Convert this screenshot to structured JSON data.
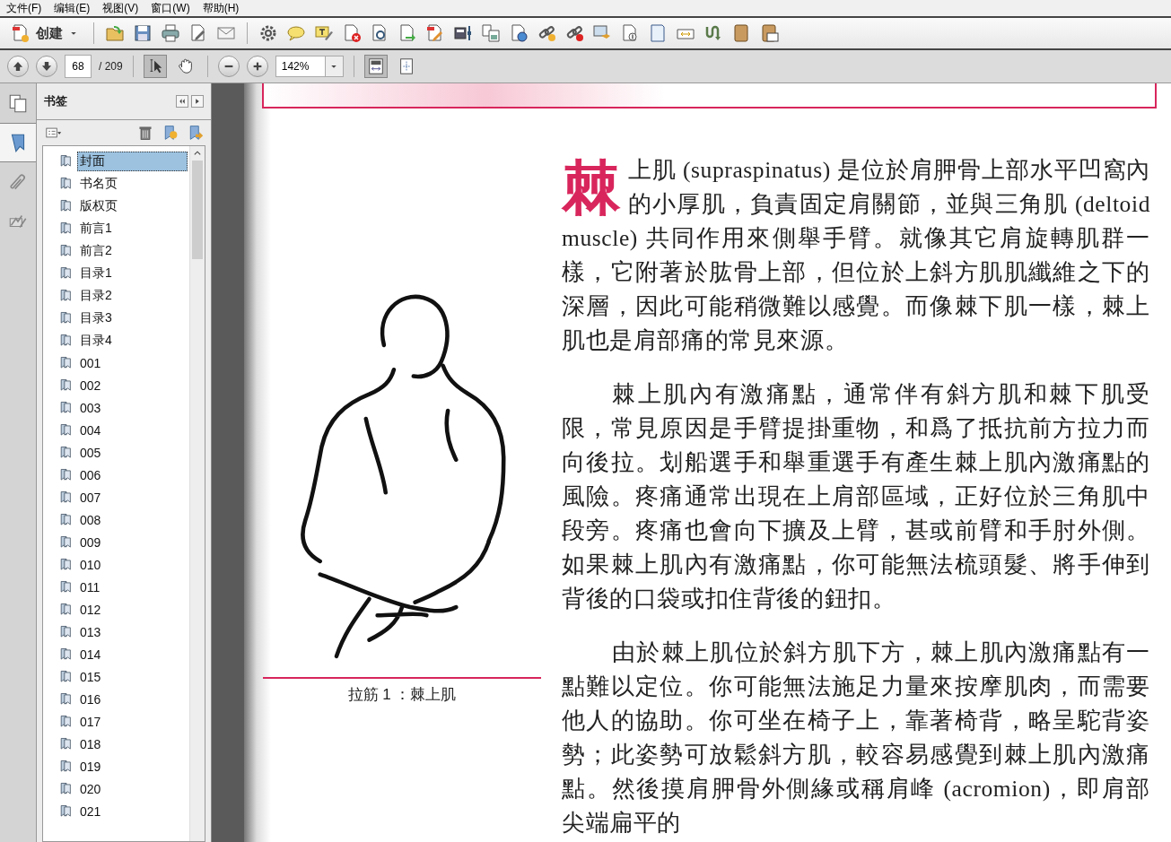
{
  "menu": [
    {
      "label": "文件(F)"
    },
    {
      "label": "编辑(E)"
    },
    {
      "label": "视图(V)"
    },
    {
      "label": "窗口(W)"
    },
    {
      "label": "帮助(H)"
    }
  ],
  "toolbar": {
    "create_label": "创建"
  },
  "navigation": {
    "page": "68",
    "total": "/ 209",
    "zoom": "142%",
    "tools": [
      {
        "kind": "select",
        "selected": true
      },
      {
        "kind": "hand",
        "selected": false
      }
    ],
    "views": [
      {
        "kind": "fit-page",
        "selected": true
      },
      {
        "kind": "fit-window",
        "selected": false
      }
    ]
  },
  "side_tabs": [
    {
      "kind": "pages",
      "selected": false
    },
    {
      "kind": "bookmarks",
      "selected": true
    },
    {
      "kind": "attachments",
      "selected": false
    },
    {
      "kind": "signatures",
      "selected": false
    }
  ],
  "bookmarks": {
    "title": "书签",
    "items": [
      {
        "label": "封面",
        "selected": true
      },
      {
        "label": "书名页",
        "selected": false
      },
      {
        "label": "版权页",
        "selected": false
      },
      {
        "label": "前言1",
        "selected": false
      },
      {
        "label": "前言2",
        "selected": false
      },
      {
        "label": "目录1",
        "selected": false
      },
      {
        "label": "目录2",
        "selected": false
      },
      {
        "label": "目录3",
        "selected": false
      },
      {
        "label": "目录4",
        "selected": false
      },
      {
        "label": "001",
        "selected": false
      },
      {
        "label": "002",
        "selected": false
      },
      {
        "label": "003",
        "selected": false
      },
      {
        "label": "004",
        "selected": false
      },
      {
        "label": "005",
        "selected": false
      },
      {
        "label": "006",
        "selected": false
      },
      {
        "label": "007",
        "selected": false
      },
      {
        "label": "008",
        "selected": false
      },
      {
        "label": "009",
        "selected": false
      },
      {
        "label": "010",
        "selected": false
      },
      {
        "label": "011",
        "selected": false
      },
      {
        "label": "012",
        "selected": false
      },
      {
        "label": "013",
        "selected": false
      },
      {
        "label": "014",
        "selected": false
      },
      {
        "label": "015",
        "selected": false
      },
      {
        "label": "016",
        "selected": false
      },
      {
        "label": "017",
        "selected": false
      },
      {
        "label": "018",
        "selected": false
      },
      {
        "label": "019",
        "selected": false
      },
      {
        "label": "020",
        "selected": false
      },
      {
        "label": "021",
        "selected": false
      }
    ]
  },
  "page": {
    "caption": "拉筋 1 ：棘上肌",
    "paragraphs": [
      {
        "drop_cap": "棘",
        "text": "上肌 (supraspinatus) 是位於肩胛骨上部水平凹窩內的小厚肌，負責固定肩關節，並與三角肌 (deltoid muscle) 共同作用來側舉手臂。就像其它肩旋轉肌群一樣，它附著於肱骨上部，但位於上斜方肌肌纖維之下的深層，因此可能稍微難以感覺。而像棘下肌一樣，棘上肌也是肩部痛的常見來源。"
      },
      {
        "text": "棘上肌內有激痛點，通常伴有斜方肌和棘下肌受限，常見原因是手臂提掛重物，和爲了抵抗前方拉力而向後拉。划船選手和舉重選手有產生棘上肌內激痛點的風險。疼痛通常出現在上肩部區域，正好位於三角肌中段旁。疼痛也會向下擴及上臂，甚或前臂和手肘外側。如果棘上肌內有激痛點，你可能無法梳頭髮、將手伸到背後的口袋或扣住背後的鈕扣。"
      },
      {
        "text": "由於棘上肌位於斜方肌下方，棘上肌內激痛點有一點難以定位。你可能無法施足力量來按摩肌肉，而需要他人的協助。你可坐在椅子上，靠著椅背，略呈駝背姿勢；此姿勢可放鬆斜方肌，較容易感覺到棘上肌內激痛點。然後摸肩胛骨外側緣或稱肩峰 (acromion)，即肩部尖端扁平的"
      }
    ]
  }
}
